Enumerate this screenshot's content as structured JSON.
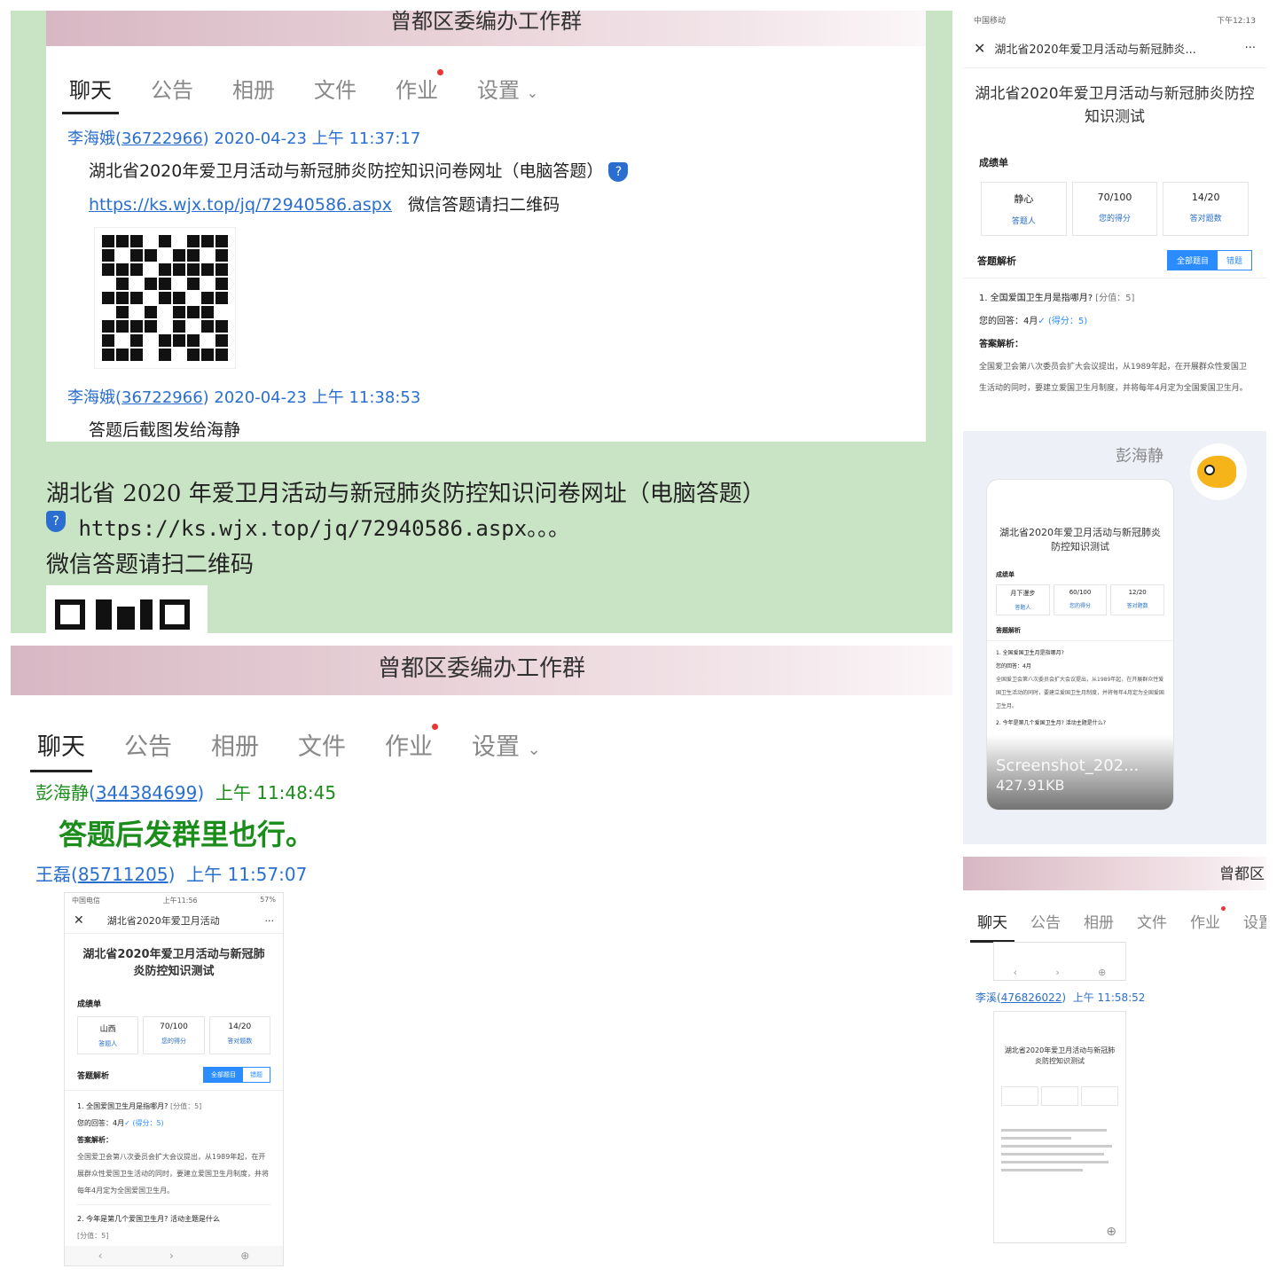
{
  "panel1": {
    "group_title": "曾都区委编办工作群",
    "tabs": [
      "聊天",
      "公告",
      "相册",
      "文件",
      "作业",
      "设置"
    ],
    "msg1": {
      "sender": "李海娥",
      "sender_id": "36722966",
      "time": "2020-04-23 上午 11:37:17",
      "text": "湖北省2020年爱卫月活动与新冠肺炎防控知识问卷网址（电脑答题）",
      "link": "https://ks.wjx.top/jq/72940586.aspx",
      "link_suffix": "微信答题请扫二维码"
    },
    "msg2": {
      "sender": "李海娥",
      "sender_id": "36722966",
      "time": "2020-04-23 上午 11:38:53",
      "text": "答题后截图发给海静"
    },
    "doc_line1": "湖北省 2020 年爱卫月活动与新冠肺炎防控知识问卷网址（电脑答题）",
    "doc_link": "https://ks.wjx.top/jq/72940586.aspx",
    "doc_link_tail": "。。。",
    "doc_line3": "微信答题请扫二维码"
  },
  "panel2": {
    "group_title": "曾都区委编办工作群",
    "tabs": [
      "聊天",
      "公告",
      "相册",
      "文件",
      "作业",
      "设置"
    ],
    "msg1": {
      "sender": "彭海静",
      "sender_id": "344384699",
      "time": "上午 11:48:45",
      "text": "答题后发群里也行。"
    },
    "msg2": {
      "sender": "王磊",
      "sender_id": "85711205",
      "time": "上午 11:57:07"
    },
    "phone": {
      "status_left": "中国电信",
      "status_mid": "上午11:56",
      "status_right": "57%",
      "nav_title": "湖北省2020年爱卫月活动",
      "title": "湖北省2020年爱卫月活动与新冠肺炎防控知识测试",
      "scorecard": "成绩单",
      "scores": [
        {
          "v": "山西",
          "l": "答题人"
        },
        {
          "v": "70/100",
          "l": "您的得分"
        },
        {
          "v": "14/20",
          "l": "答对题数"
        }
      ],
      "analysis": "答题解析",
      "toggle": [
        "全部题目",
        "错题"
      ],
      "q1": "1. 全国爱国卫生月是指哪月?",
      "q1_score": "[分值：5]",
      "q1_answer": "您的回答：4月",
      "q1_got": "(得分：5)",
      "explain_label": "答案解析：",
      "explain": "全国爱卫会第八次委员会扩大会议提出，从1989年起，在开展群众性爱国卫生活动的同时，要建立爱国卫生月制度，并将每年4月定为全国爱国卫生月。",
      "q2": "2. 今年是第几个爱国卫生月? 活动主题是什么",
      "q2_score": "[分值：5]"
    }
  },
  "panel3": {
    "status_left": "中国移动",
    "status_right": "下午12:13",
    "nav_title": "湖北省2020年爱卫月活动与新冠肺炎...",
    "title": "湖北省2020年爱卫月活动与新冠肺炎防控知识测试",
    "scorecard": "成绩单",
    "scores": [
      {
        "v": "静心",
        "l": "答题人"
      },
      {
        "v": "70/100",
        "l": "您的得分"
      },
      {
        "v": "14/20",
        "l": "答对题数"
      }
    ],
    "analysis": "答题解析",
    "toggle": [
      "全部题目",
      "错题"
    ],
    "q1": "1. 全国爱国卫生月是指哪月?",
    "q1_score": "[分值：5]",
    "q1_answer": "您的回答：4月",
    "q1_got": "(得分：5)",
    "explain_label": "答案解析：",
    "explain": "全国爱卫会第八次委员会扩大会议提出，从1989年起，在开展群众性爱国卫生活动的同时，要建立爱国卫生月制度，并将每年4月定为全国爱国卫生月。"
  },
  "panel4": {
    "sender": "彭海静",
    "phone_title": "湖北省2020年爱卫月活动与新冠肺炎防控知识测试",
    "scorecard": "成绩单",
    "scores": [
      {
        "v": "月下漫步",
        "l": "答题人"
      },
      {
        "v": "60/100",
        "l": "您的得分"
      },
      {
        "v": "12/20",
        "l": "答对题数"
      }
    ],
    "analysis": "答题解析",
    "q1": "1. 全国爱国卫生月是指哪月?",
    "q1_answer": "您的回答：4月",
    "explain": "全国爱卫会第八次委员会扩大会议提出，从1989年起，在开展群众性爱国卫生活动的同时，要建立爱国卫生月制度，并将每年4月定为全国爱国卫生月。",
    "q2": "2. 今年是第几个爱国卫生月? 活动主题是什么?",
    "file_name": "Screenshot_202...",
    "file_size": "427.91KB"
  },
  "panel5": {
    "group_title": "曾都区",
    "tabs": [
      "聊天",
      "公告",
      "相册",
      "文件",
      "作业",
      "设置"
    ],
    "sender": "李溪",
    "sender_id": "476826022",
    "time": "上午 11:58:52",
    "phone_title": "湖北省2020年爱卫月活动与新冠肺炎防控知识测试"
  }
}
